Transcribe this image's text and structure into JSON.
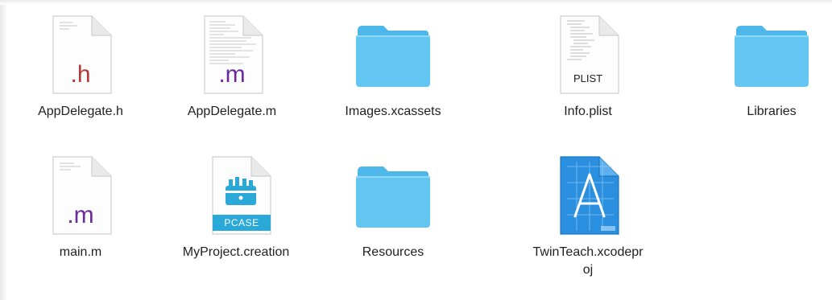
{
  "files": [
    {
      "name": "AppDelegate.h",
      "kind": "doc-text",
      "badge": ".h",
      "badge_color": "#b23a3a",
      "icon": "header-file-icon"
    },
    {
      "name": "AppDelegate.m",
      "kind": "doc-text",
      "badge": ".m",
      "badge_color": "#6a2a9a",
      "icon": "source-file-icon"
    },
    {
      "name": "Images.xcassets",
      "kind": "folder",
      "icon": "folder-icon"
    },
    {
      "name": "Info.plist",
      "kind": "doc-plist",
      "badge": "PLIST",
      "badge_color": "#222222",
      "icon": "plist-file-icon"
    },
    {
      "name": "Libraries",
      "kind": "folder",
      "icon": "folder-icon"
    },
    {
      "name": "main.m",
      "kind": "doc-text",
      "badge": ".m",
      "badge_color": "#6a2a9a",
      "icon": "source-file-icon"
    },
    {
      "name": "MyProject.creation",
      "kind": "pcase",
      "badge": "PCASE",
      "badge_color": "#2aa8d8",
      "icon": "pcase-file-icon"
    },
    {
      "name": "Resources",
      "kind": "folder",
      "icon": "folder-icon"
    },
    {
      "name": "TwinTeach.xcodepr\noj",
      "kind": "xcodeproj",
      "icon": "xcode-project-icon"
    }
  ],
  "colors": {
    "folder": "#5ec3f0",
    "folder_tab": "#4db7ea",
    "xcode_blue": "#2b8fe0"
  }
}
